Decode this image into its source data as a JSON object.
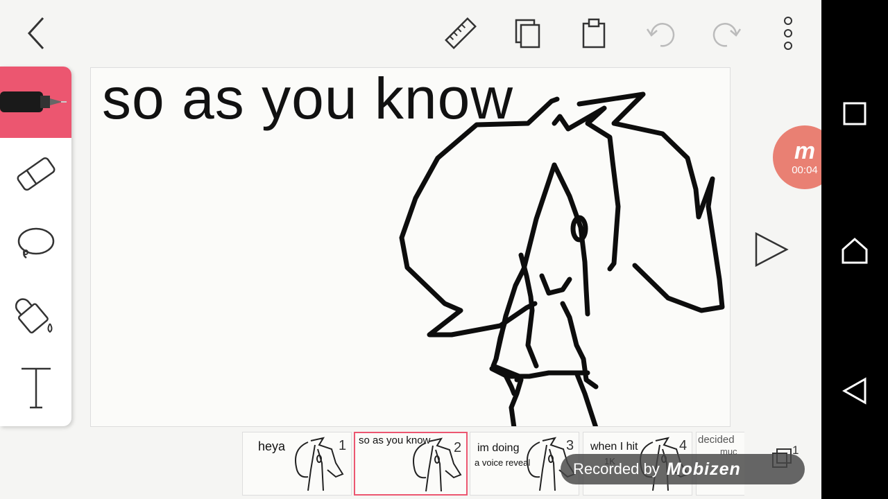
{
  "toolbar": {
    "icons": [
      "back-icon",
      "ruler-icon",
      "copy-icon",
      "paste-icon",
      "undo-icon",
      "redo-icon",
      "more-icon"
    ]
  },
  "tools": [
    "pen-icon",
    "eraser-icon",
    "lasso-icon",
    "fill-bucket-icon",
    "text-tool-icon"
  ],
  "canvas": {
    "text": "so as you know"
  },
  "record": {
    "logo": "m",
    "time": "00:04"
  },
  "frames": [
    {
      "caption": "heya",
      "sub": "",
      "num": "1"
    },
    {
      "caption": "so as you know",
      "sub": "",
      "num": "2"
    },
    {
      "caption": "im doing",
      "sub": "a voice reveal",
      "num": "3"
    },
    {
      "caption": "when I hit",
      "sub": "1K",
      "num": "4"
    },
    {
      "caption": "decided",
      "sub": "muc",
      "num": ""
    }
  ],
  "layer_count": "1",
  "watermark": {
    "label": "Recorded by",
    "brand": "Mobizen"
  },
  "colors": {
    "accent": "#ec5670",
    "record": "#e97a6d",
    "nav": "#000000"
  }
}
